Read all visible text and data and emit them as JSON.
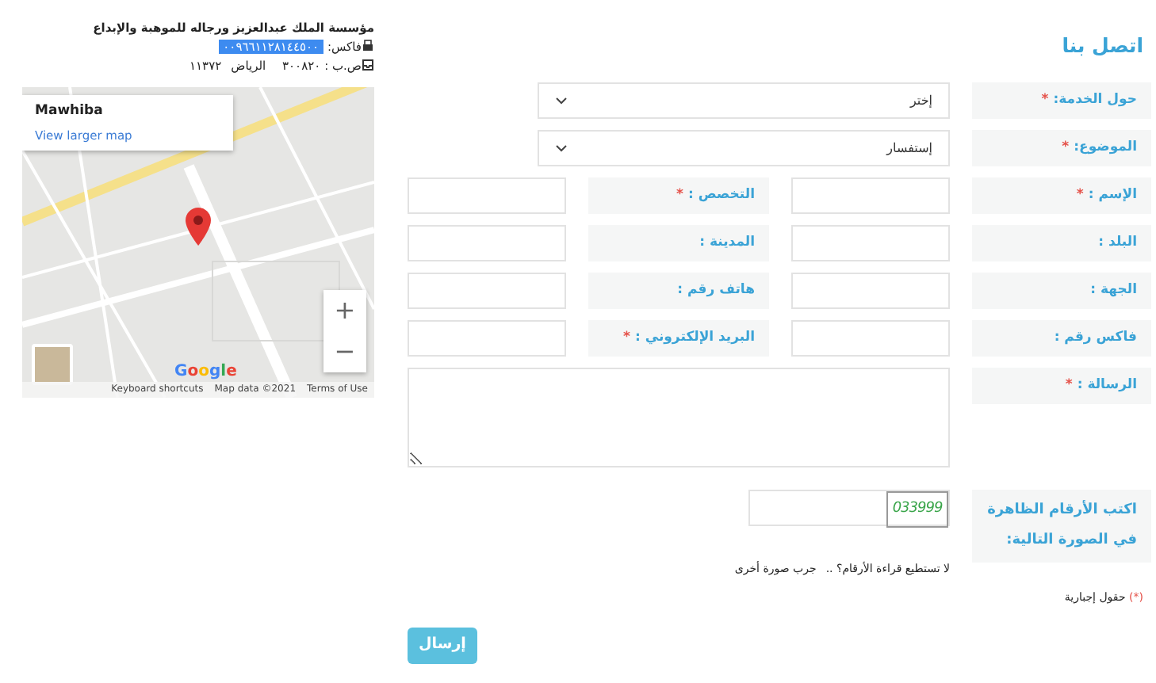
{
  "info": {
    "org_name": "مؤسسة الملك عبدالعزيز ورجاله للموهبة والإبداع",
    "fax": {
      "label": "فاكس:",
      "value": "٠٠٩٦٦١١٢٨١٤٤٥٠٠",
      "highlighted": true
    },
    "pobox": {
      "label": "ص.ب :",
      "number": "٣٠٠٨٢٠",
      "city": "الرياض",
      "postal_code": "١١٣٧٢"
    }
  },
  "map": {
    "place_title": "Mawhiba",
    "link": "View larger map",
    "zoom_in": "+",
    "zoom_out": "−",
    "logo": "Google",
    "keyboard_shortcuts": "Keyboard shortcuts",
    "map_data": "Map data ©2021",
    "terms": "Terms of Use"
  },
  "form": {
    "title": "اتصل بنا",
    "rows": [
      {
        "fields": [
          {
            "kind": "select",
            "label": "حول الخدمة:",
            "required_mark": "*",
            "value": "إختر"
          }
        ]
      },
      {
        "fields": [
          {
            "kind": "select",
            "label": "الموضوع:",
            "required_mark": "*",
            "value": "إستفسار"
          }
        ]
      },
      {
        "fields": [
          {
            "kind": "text",
            "label": "الإسم :",
            "required_mark": "*"
          },
          {
            "kind": "text",
            "label": "التخصص :",
            "required_mark": "*"
          }
        ]
      },
      {
        "fields": [
          {
            "kind": "text",
            "label": "البلد :"
          },
          {
            "kind": "text",
            "label": "المدينة :"
          }
        ]
      },
      {
        "fields": [
          {
            "kind": "text",
            "label": "الجهة :"
          },
          {
            "kind": "text",
            "label": "هاتف رقم :"
          }
        ]
      },
      {
        "fields": [
          {
            "kind": "text",
            "label": "فاكس رقم :"
          },
          {
            "kind": "text",
            "label": "البريد الإلكتروني :",
            "required_mark": "*"
          }
        ]
      },
      {
        "fields": [
          {
            "kind": "textarea",
            "label": "الرسالة :",
            "required_mark": "*"
          }
        ]
      }
    ],
    "captcha": {
      "label": "اكتب الأرقام الظاهرة في الصورة التالية:",
      "image_text": "033999"
    },
    "captcha_help": {
      "text": "لا تستطيع قراءة الأرقام؟ ..",
      "link": "جرب صورة أخرى"
    },
    "required_note": {
      "mark": "(*)",
      "text": "حقول إجبارية"
    },
    "submit": "إرسال"
  }
}
